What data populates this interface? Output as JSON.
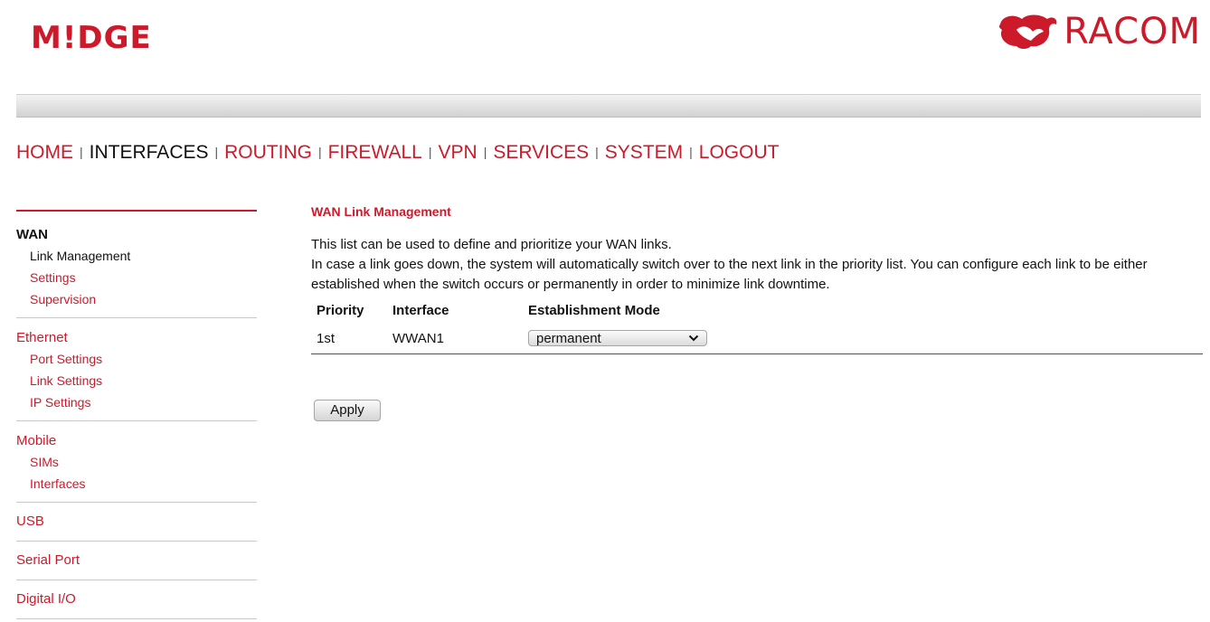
{
  "brand": {
    "product": "M!DGE",
    "company": "RACOM"
  },
  "colors": {
    "accent": "#cc1a2b",
    "header_bar": "#d8d8d8"
  },
  "topnav": [
    {
      "label": "HOME",
      "active": false
    },
    {
      "label": "INTERFACES",
      "active": true
    },
    {
      "label": "ROUTING",
      "active": false
    },
    {
      "label": "FIREWALL",
      "active": false
    },
    {
      "label": "VPN",
      "active": false
    },
    {
      "label": "SERVICES",
      "active": false
    },
    {
      "label": "SYSTEM",
      "active": false
    },
    {
      "label": "LOGOUT",
      "active": false
    }
  ],
  "nav_separator": "|",
  "sidebar": {
    "wan": {
      "label": "WAN",
      "items": [
        "Link Management",
        "Settings",
        "Supervision"
      ]
    },
    "ethernet": {
      "label": "Ethernet",
      "items": [
        "Port Settings",
        "Link Settings",
        "IP Settings"
      ]
    },
    "mobile": {
      "label": "Mobile",
      "items": [
        "SIMs",
        "Interfaces"
      ]
    },
    "usb": {
      "label": "USB"
    },
    "serial": {
      "label": "Serial Port"
    },
    "dio": {
      "label": "Digital I/O"
    }
  },
  "main": {
    "title": "WAN Link Management",
    "desc1": "This list can be used to define and prioritize your WAN links.",
    "desc2": "In case a link goes down, the system will automatically switch over to the next link in the priority list. You can configure each link to be either established when the switch occurs or permanently in order to minimize link downtime.",
    "table": {
      "headers": [
        "Priority",
        "Interface",
        "Establishment Mode"
      ],
      "rows": [
        {
          "priority": "1st",
          "interface": "WWAN1",
          "mode": "permanent"
        }
      ]
    },
    "apply_label": "Apply"
  }
}
